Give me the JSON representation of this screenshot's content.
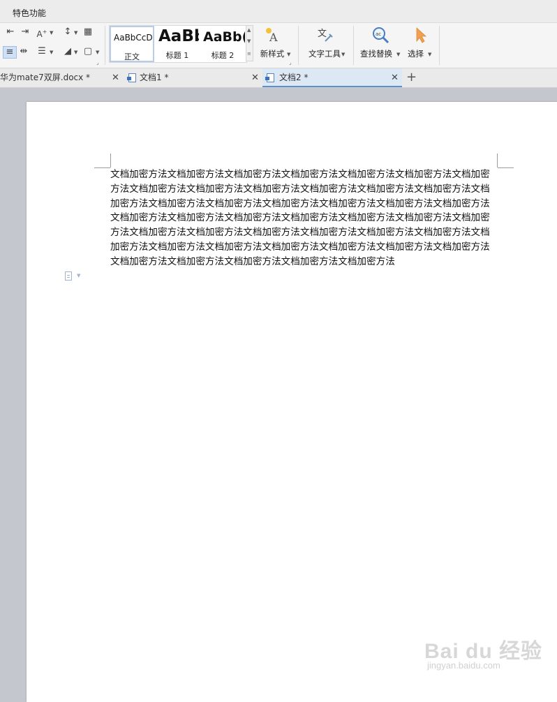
{
  "menubar": {
    "item": "特色功能"
  },
  "ribbon": {
    "styles": [
      {
        "sample": "AaBbCcDd",
        "label": "正文"
      },
      {
        "sample": "AaBb",
        "label": "标题 1"
      },
      {
        "sample": "AaBb(",
        "label": "标题 2"
      }
    ],
    "new_style_label": "新样式",
    "text_tools_label": "文字工具",
    "find_replace_label": "查找替换",
    "select_label": "选择"
  },
  "tabs": [
    {
      "label": "华为mate7双屏.docx *"
    },
    {
      "label": "文档1 *"
    },
    {
      "label": "文档2 *"
    }
  ],
  "document": {
    "body_text": "文档加密方法文档加密方法文档加密方法文档加密方法文档加密方法文档加密方法文档加密方法文档加密方法文档加密方法文档加密方法文档加密方法文档加密方法文档加密方法文档加密方法文档加密方法文档加密方法文档加密方法文档加密方法文档加密方法文档加密方法文档加密方法文档加密方法文档加密方法文档加密方法文档加密方法文档加密方法文档加密方法文档加密方法文档加密方法文档加密方法文档加密方法文档加密方法文档加密方法文档加密方法文档加密方法文档加密方法文档加密方法文档加密方法文档加密方法文档加密方法文档加密方法文档加密方法文档加密方法文档加密方法文档加密方法"
  },
  "watermark": {
    "main": "Bai du 经验",
    "sub": "jingyan.baidu.com"
  },
  "colors": {
    "accent": "#5b8fd1",
    "page_bg": "#c4c7cd",
    "select_arrow": "#f0a050"
  }
}
